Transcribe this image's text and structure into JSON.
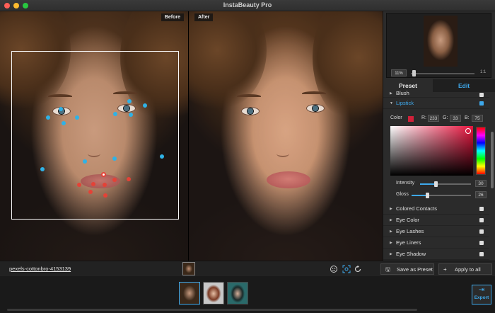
{
  "window": {
    "title": "InstaBeauty Pro"
  },
  "photo": {
    "before_label": "Before",
    "after_label": "After"
  },
  "navigator": {
    "zoom": "11%",
    "fit_label": "1:1"
  },
  "tabs": {
    "preset": "Preset",
    "edit": "Edit"
  },
  "panel": {
    "blush_label": "Blush",
    "lipstick_label": "Lipstick",
    "color": {
      "label": "Color",
      "swatch": "#d1213a",
      "r_label": "R:",
      "r": "233",
      "g_label": "G:",
      "g": "33",
      "b_label": "B:",
      "b": "75"
    },
    "intensity": {
      "label": "Intensity",
      "value": "30"
    },
    "gloss": {
      "label": "Gloss",
      "value": "26"
    },
    "features": [
      "Colored Contacts",
      "Eye Color",
      "Eye Lashes",
      "Eye Liners",
      "Eye Shadow"
    ]
  },
  "bottom": {
    "file_name": "pexels-cottonbro-4153139",
    "save_preset": "Save as Preset",
    "apply_all": "Apply to all",
    "export": "Export"
  },
  "colors": {
    "accent": "#3ea9ec",
    "landmark_blue": "#2fb2e6",
    "landmark_red": "#e44237"
  }
}
